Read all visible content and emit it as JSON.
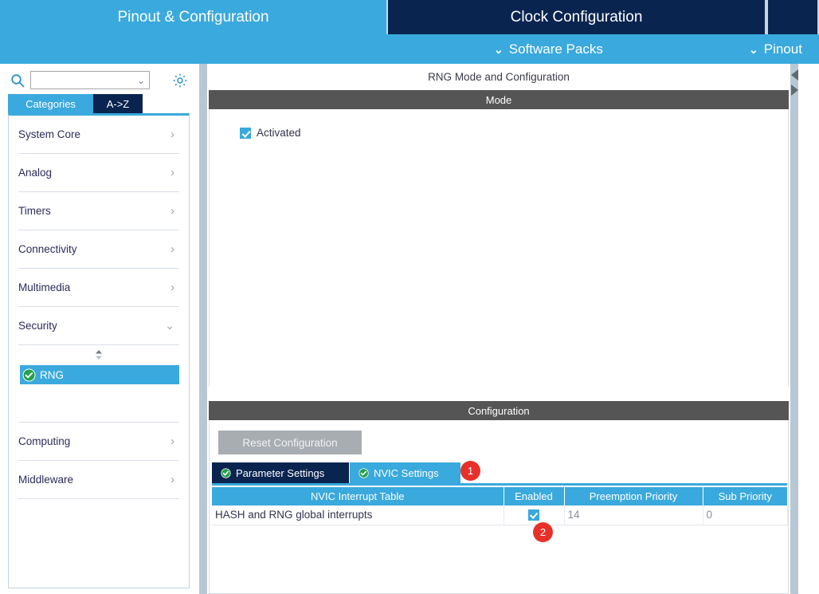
{
  "header": {
    "tabs": [
      {
        "label": "Pinout & Configuration",
        "active": true
      },
      {
        "label": "Clock Configuration",
        "active": false
      },
      {
        "label": "",
        "active": false
      }
    ],
    "subbar": [
      {
        "label": "Software Packs",
        "icon": "chevron-down-icon"
      },
      {
        "label": "Pinout",
        "icon": "chevron-down-icon"
      }
    ]
  },
  "sidebar": {
    "search": {
      "value": "",
      "placeholder": "",
      "icon": "search-icon",
      "chevron": "chevron-down-icon"
    },
    "gear": {
      "icon": "gear-icon"
    },
    "tabs": [
      {
        "label": "Categories",
        "selected": true
      },
      {
        "label": "A->Z",
        "selected": false
      }
    ],
    "categories": [
      {
        "label": "System Core",
        "arrow": "›",
        "expanded": false
      },
      {
        "label": "Analog",
        "arrow": "›",
        "expanded": false
      },
      {
        "label": "Timers",
        "arrow": "›",
        "expanded": false
      },
      {
        "label": "Connectivity",
        "arrow": "›",
        "expanded": false
      },
      {
        "label": "Multimedia",
        "arrow": "›",
        "expanded": false
      },
      {
        "label": "Security",
        "arrow": "⌄",
        "expanded": true
      },
      {
        "label": "Computing",
        "arrow": "›",
        "expanded": false
      },
      {
        "label": "Middleware",
        "arrow": "›",
        "expanded": false
      }
    ],
    "peripherals": [
      {
        "label": "RNG",
        "selected": true,
        "status": "check-circle-icon"
      }
    ]
  },
  "main": {
    "title": "RNG Mode and Configuration",
    "mode": {
      "header": "Mode",
      "checkbox": {
        "label": "Activated",
        "checked": true
      }
    },
    "configuration": {
      "header": "Configuration",
      "reset_button": "Reset Configuration",
      "tabs": [
        {
          "label": "Parameter Settings",
          "active": false,
          "icon": "check-circle-icon"
        },
        {
          "label": "NVIC Settings",
          "active": true,
          "icon": "check-circle-icon"
        }
      ],
      "table": {
        "columns": [
          "NVIC Interrupt Table",
          "Enabled",
          "Preemption Priority",
          "Sub Priority"
        ],
        "rows": [
          {
            "name": "HASH and RNG global interrupts",
            "enabled": true,
            "preemption_priority": "14",
            "sub_priority": "0"
          }
        ]
      }
    }
  },
  "annotations": [
    {
      "number": "1",
      "target": "nvic-settings-tab"
    },
    {
      "number": "2",
      "target": "enabled-checkbox"
    }
  ],
  "colors": {
    "accent_blue": "#3aa9dd",
    "dark_navy": "#0a2450",
    "section_gray": "#555555",
    "badge_red": "#e8302a",
    "status_green": "#22a14a"
  }
}
